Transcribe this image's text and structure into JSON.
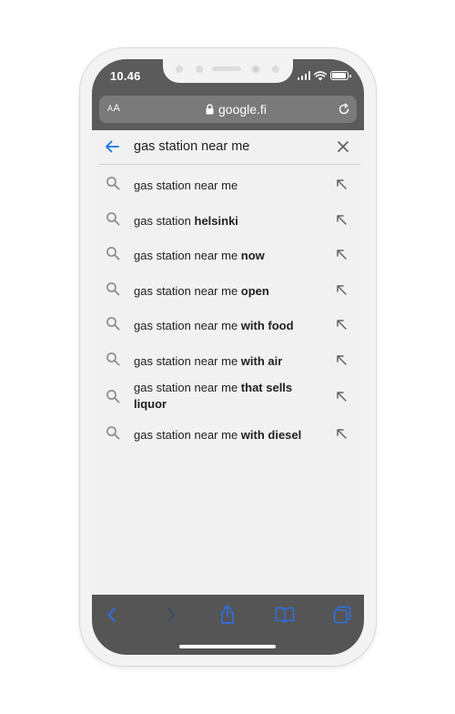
{
  "status_bar": {
    "time": "10.46"
  },
  "address_bar": {
    "aa_label_small": "A",
    "aa_label_large": "A",
    "domain": "google.fi"
  },
  "search": {
    "query": "gas station near me",
    "suggestions": [
      {
        "base": "gas station near me",
        "bold": ""
      },
      {
        "base": "gas station ",
        "bold": "helsinki"
      },
      {
        "base": "gas station near me ",
        "bold": "now"
      },
      {
        "base": "gas station near me ",
        "bold": "open"
      },
      {
        "base": "gas station near me ",
        "bold": "with food"
      },
      {
        "base": "gas station near me ",
        "bold": "with air"
      },
      {
        "base": "gas station near me ",
        "bold": "that sells liquor"
      },
      {
        "base": "gas station near me ",
        "bold": "with diesel"
      }
    ]
  },
  "toolbar": {
    "icons": [
      "back-icon",
      "forward-icon",
      "share-icon",
      "bookmarks-icon",
      "tabs-icon"
    ],
    "active_color": "#2f6fde",
    "disabled_color": "#3a4a6a"
  },
  "colors": {
    "accent": "#1a73e8",
    "top_bar": "#5b5b5b",
    "url_field": "#7a7a7a",
    "bottom_bar": "#555555"
  }
}
